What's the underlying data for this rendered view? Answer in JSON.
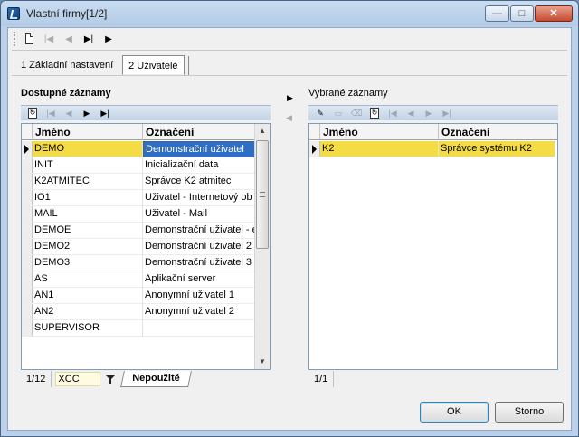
{
  "window": {
    "title": "Vlastní firmy[1/2]",
    "controls": {
      "minimize": "—",
      "maximize": "□",
      "close": "✕"
    }
  },
  "toolbar": {
    "icons": [
      "new-document-icon",
      "first-record-icon",
      "previous-record-icon",
      "next-record-icon",
      "last-record-icon"
    ]
  },
  "tabs": [
    {
      "label": "1 Základní nastavení",
      "active": false
    },
    {
      "label": "2 Uživatelé",
      "active": true
    }
  ],
  "left_panel": {
    "label": "Dostupné záznamy",
    "columns": [
      "Jméno",
      "Označení"
    ],
    "rows": [
      {
        "name": "DEMO",
        "label": "Demonstrační uživatel"
      },
      {
        "name": "INIT",
        "label": "Inicializační data"
      },
      {
        "name": "K2ATMITEC",
        "label": "Správce K2 atmitec"
      },
      {
        "name": "IO1",
        "label": "Uživatel - Internetový ob"
      },
      {
        "name": "MAIL",
        "label": "Uživatel - Mail"
      },
      {
        "name": "DEMOE",
        "label": "Demonstrační uživatel - e"
      },
      {
        "name": "DEMO2",
        "label": "Demonstrační uživatel 2"
      },
      {
        "name": "DEMO3",
        "label": "Demonstrační uživatel 3"
      },
      {
        "name": "AS",
        "label": "Aplikační server"
      },
      {
        "name": "AN1",
        "label": "Anonymní uživatel 1"
      },
      {
        "name": "AN2",
        "label": "Anonymní uživatel 2"
      },
      {
        "name": "SUPERVISOR",
        "label": ""
      }
    ],
    "selected_index": 0,
    "status": {
      "count": "1/12",
      "filter_value": "XCC",
      "bottom_tab": "Nepoužité"
    }
  },
  "right_panel": {
    "label": "Vybrané záznamy",
    "columns": [
      "Jméno",
      "Označení"
    ],
    "rows": [
      {
        "name": "K2",
        "label": "Správce systému K2"
      }
    ],
    "selected_index": 0,
    "status": {
      "count": "1/1"
    }
  },
  "buttons": {
    "ok": "OK",
    "cancel": "Storno"
  },
  "colors": {
    "selection": "#f4dc45",
    "focus_cell": "#2f6ec7",
    "window_frame": "#bcd1e9"
  }
}
